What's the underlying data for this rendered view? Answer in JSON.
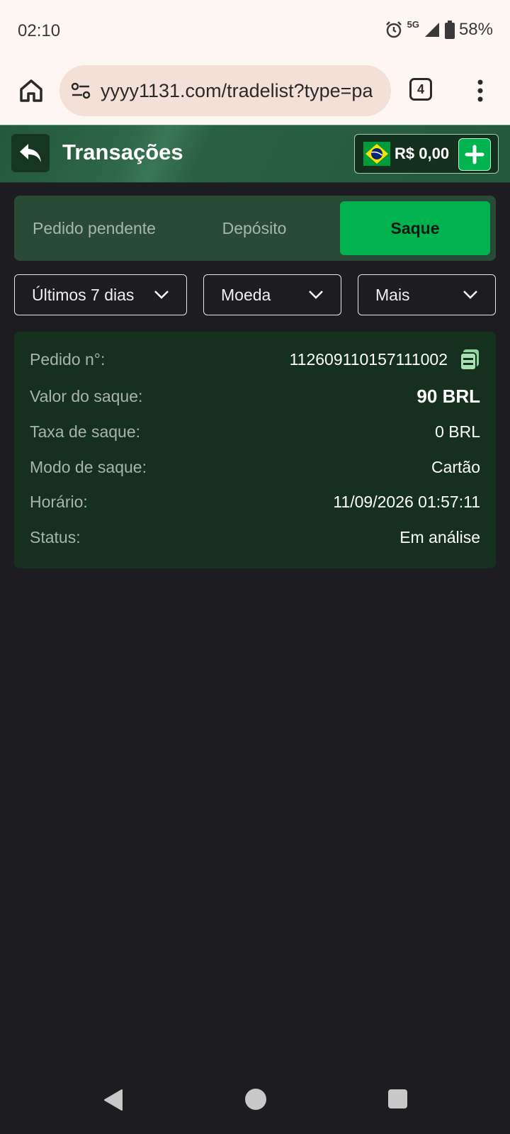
{
  "status_bar": {
    "time": "02:10",
    "network": "5G",
    "battery": "58%",
    "icons": [
      "alarm-icon",
      "signal-icon",
      "battery-icon"
    ]
  },
  "browser": {
    "url": "yyyy1131.com/tradelist?type=pa",
    "tab_count": "4"
  },
  "header": {
    "title": "Transações",
    "balance": "R$ 0,00"
  },
  "tabs": [
    {
      "label": "Pedido pendente",
      "active": false
    },
    {
      "label": "Depósito",
      "active": false
    },
    {
      "label": "Saque",
      "active": true
    }
  ],
  "filters": {
    "period": "Últimos 7 dias",
    "currency": "Moeda",
    "more": "Mais"
  },
  "transaction": {
    "rows": [
      {
        "label": "Pedido n°:",
        "value": "112609110157111002"
      },
      {
        "label": "Valor do saque:",
        "value": "90 BRL"
      },
      {
        "label": "Taxa de saque:",
        "value": "0 BRL"
      },
      {
        "label": "Modo de saque:",
        "value": "Cartão"
      },
      {
        "label": "Horário:",
        "value": "11/09/2026 01:57:11"
      },
      {
        "label": "Status:",
        "value": "Em análise"
      }
    ]
  },
  "colors": {
    "accent": "#00b34f",
    "header_bg": "#24583a",
    "card_bg": "#16301f",
    "page_bg": "#1c1c21"
  }
}
